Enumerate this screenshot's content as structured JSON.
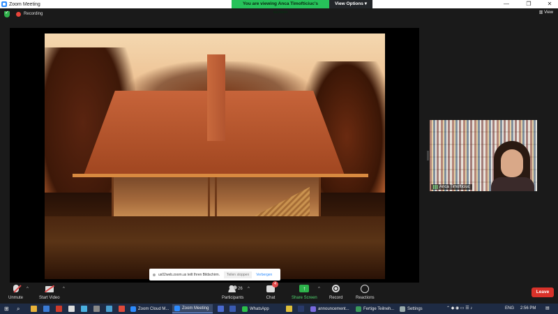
{
  "window": {
    "title": "Zoom Meeting",
    "minimize": "—",
    "restore": "❐",
    "close": "✕"
  },
  "banner": {
    "viewing_text": "You are viewing Anca Timofticiuc's screen",
    "view_options": "View Options ▾"
  },
  "info": {
    "recording_label": "Recording",
    "view_label": "View"
  },
  "share_notice": {
    "message": "us02web.zoom.us teilt Ihren Bildschirm.",
    "stop": "Teilen stoppen",
    "hide": "Verbergen"
  },
  "participant": {
    "name": "Anca Timofticiuc"
  },
  "toolbar": {
    "unmute": "Unmute",
    "start_video": "Start Video",
    "participants": "Participants",
    "participants_count": "26",
    "chat": "Chat",
    "chat_badge": "4",
    "share_screen": "Share Screen",
    "record": "Record",
    "reactions": "Reactions",
    "leave": "Leave",
    "caret": "^"
  },
  "taskbar": {
    "apps": [
      "Zoom Cloud M...",
      "Zoom Meeting",
      "WhatsApp",
      "announcement...",
      "Fertige Teilneh...",
      "Settings"
    ],
    "language": "ENG",
    "time": "2:56 PM"
  },
  "colors": {
    "accent_green": "#27c25a",
    "leave_red": "#d8322a",
    "taskbar": "#1e2b44"
  },
  "icons": [
    "zoom-icon",
    "shield-icon",
    "record-dot-icon",
    "view-icon",
    "microphone-muted-icon",
    "video-muted-icon",
    "participants-icon",
    "chat-icon",
    "share-screen-icon",
    "record-icon",
    "reactions-icon",
    "windows-start-icon",
    "search-icon",
    "signal-bars-icon"
  ]
}
